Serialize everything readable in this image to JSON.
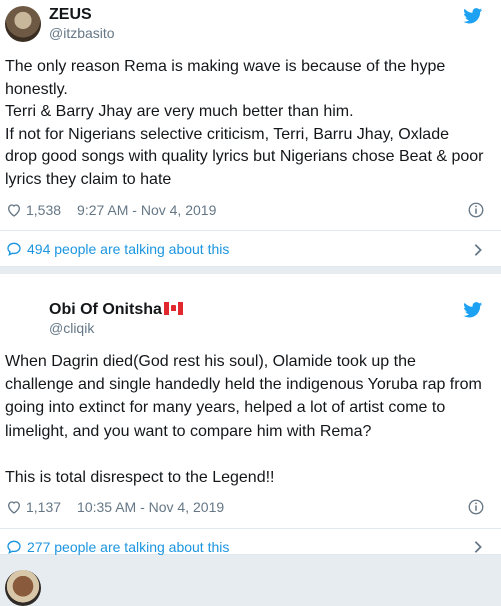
{
  "tweets": [
    {
      "display_name": "ZEUS",
      "handle": "@itzbasito",
      "text": "The only reason Rema is making wave is because of the hype\nhonestly.\nTerri & Barry Jhay are very much better than him.\nIf not for Nigerians selective criticism, Terri, Barru Jhay, Oxlade\ndrop good songs with quality lyrics but Nigerians chose Beat & poor\nlyrics they claim to hate",
      "likes": "1,538",
      "timestamp": "9:27 AM - Nov 4, 2019",
      "talking": "494 people are talking about this"
    },
    {
      "display_name": "Obi Of Onitsha",
      "handle": "@cliqik",
      "text": "When Dagrin died(God rest his soul), Olamide took up the\nchallenge and single handedly held the indigenous Yoruba rap from\ngoing into extinct for many years, helped a lot of artist come to\nlimelight, and you want to compare him with Rema?\n\nThis is total disrespect to the Legend!!",
      "likes": "1,137",
      "timestamp": "10:35 AM - Nov 4, 2019",
      "talking": "277 people are talking about this"
    }
  ],
  "icons": {
    "brand": "twitter-bird-icon",
    "like": "heart-icon",
    "info": "info-icon",
    "reply": "speech-bubble-icon",
    "more": "chevron-right-icon",
    "flag": "canada-flag-icon"
  },
  "colors": {
    "twitter_blue": "#1da1f2",
    "link_blue": "#1b95e0",
    "secondary_text": "#657786",
    "background": "#e6ecf0"
  }
}
